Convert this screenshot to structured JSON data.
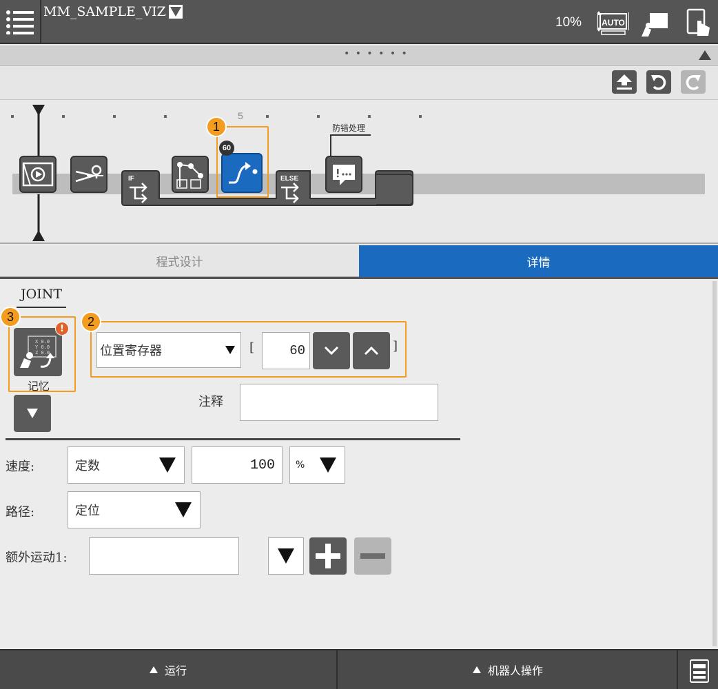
{
  "header": {
    "program_name": "MM_SAMPLE_VIZ",
    "speed": "10%",
    "mode": "AUTO"
  },
  "timeline": {
    "tick_label": "5",
    "nodes": {
      "if_label": "IF",
      "else_label": "ELSE",
      "selected_badge": "60",
      "error_label": "防错处理",
      "selected_marker": "1"
    }
  },
  "tabs": {
    "design": "程式设计",
    "detail": "详情"
  },
  "detail": {
    "motion_type": "JOINT",
    "memory_marker": "3",
    "memory_alert": "!",
    "memory_label": "记忆",
    "position_marker": "2",
    "position_source": "位置寄存器",
    "bracket_open": "[",
    "bracket_close": "]",
    "register_index": "60",
    "comment_label": "注释",
    "comment_value": "",
    "speed_label": "速度:",
    "speed_type": "定数",
    "speed_value": "100",
    "speed_unit": "%",
    "path_label": "路径:",
    "path_type": "定位",
    "extra_label": "额外运动1:",
    "extra_value": ""
  },
  "footer": {
    "run": "运行",
    "robot_ops": "机器人操作"
  },
  "colors": {
    "accent": "#1a6bbf",
    "highlight": "#f39c1f",
    "dark": "#555555"
  }
}
